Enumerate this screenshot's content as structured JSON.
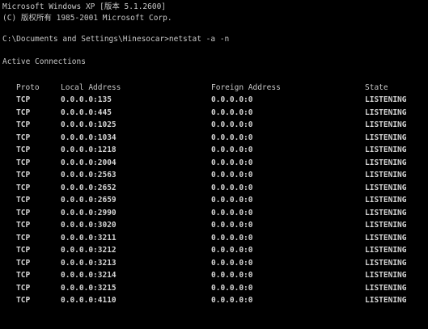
{
  "banner": {
    "line1": "Microsoft Windows XP [版本 5.1.2600]",
    "line2": "(C) 版权所有 1985-2001 Microsoft Corp."
  },
  "command": {
    "prompt": "C:\\Documents and Settings\\Hinesocar>netstat -a -n"
  },
  "section_title": "Active Connections",
  "columns": {
    "proto": "Proto",
    "local": "Local Address",
    "foreign": "Foreign Address",
    "state": "State"
  },
  "connections": [
    {
      "proto": "TCP",
      "local": "0.0.0.0:135",
      "foreign": "0.0.0.0:0",
      "state": "LISTENING"
    },
    {
      "proto": "TCP",
      "local": "0.0.0.0:445",
      "foreign": "0.0.0.0:0",
      "state": "LISTENING"
    },
    {
      "proto": "TCP",
      "local": "0.0.0.0:1025",
      "foreign": "0.0.0.0:0",
      "state": "LISTENING"
    },
    {
      "proto": "TCP",
      "local": "0.0.0.0:1034",
      "foreign": "0.0.0.0:0",
      "state": "LISTENING"
    },
    {
      "proto": "TCP",
      "local": "0.0.0.0:1218",
      "foreign": "0.0.0.0:0",
      "state": "LISTENING"
    },
    {
      "proto": "TCP",
      "local": "0.0.0.0:2004",
      "foreign": "0.0.0.0:0",
      "state": "LISTENING"
    },
    {
      "proto": "TCP",
      "local": "0.0.0.0:2563",
      "foreign": "0.0.0.0:0",
      "state": "LISTENING"
    },
    {
      "proto": "TCP",
      "local": "0.0.0.0:2652",
      "foreign": "0.0.0.0:0",
      "state": "LISTENING"
    },
    {
      "proto": "TCP",
      "local": "0.0.0.0:2659",
      "foreign": "0.0.0.0:0",
      "state": "LISTENING"
    },
    {
      "proto": "TCP",
      "local": "0.0.0.0:2990",
      "foreign": "0.0.0.0:0",
      "state": "LISTENING"
    },
    {
      "proto": "TCP",
      "local": "0.0.0.0:3020",
      "foreign": "0.0.0.0:0",
      "state": "LISTENING"
    },
    {
      "proto": "TCP",
      "local": "0.0.0.0:3211",
      "foreign": "0.0.0.0:0",
      "state": "LISTENING"
    },
    {
      "proto": "TCP",
      "local": "0.0.0.0:3212",
      "foreign": "0.0.0.0:0",
      "state": "LISTENING"
    },
    {
      "proto": "TCP",
      "local": "0.0.0.0:3213",
      "foreign": "0.0.0.0:0",
      "state": "LISTENING"
    },
    {
      "proto": "TCP",
      "local": "0.0.0.0:3214",
      "foreign": "0.0.0.0:0",
      "state": "LISTENING"
    },
    {
      "proto": "TCP",
      "local": "0.0.0.0:3215",
      "foreign": "0.0.0.0:0",
      "state": "LISTENING"
    },
    {
      "proto": "TCP",
      "local": "0.0.0.0:4110",
      "foreign": "0.0.0.0:0",
      "state": "LISTENING"
    }
  ]
}
